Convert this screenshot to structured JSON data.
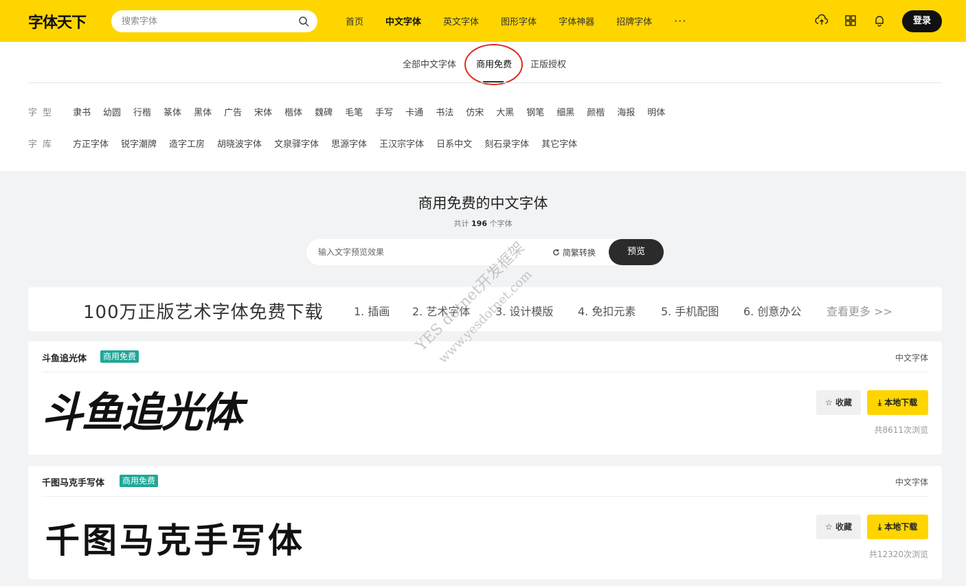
{
  "header": {
    "logo": "字体天下",
    "search_placeholder": "搜索字体",
    "nav": [
      "首页",
      "中文字体",
      "英文字体",
      "图形字体",
      "字体神器",
      "招牌字体"
    ],
    "nav_active": "中文字体",
    "nav_more": "···",
    "login": "登录",
    "icons": [
      "upload-icon",
      "grid-icon",
      "bell-icon"
    ]
  },
  "subtabs": [
    "全部中文字体",
    "商用免费",
    "正版授权"
  ],
  "subtab_active": "商用免费",
  "filters": {
    "style_label": "字型",
    "styles": [
      "隶书",
      "幼圆",
      "行楷",
      "篆体",
      "黑体",
      "广告",
      "宋体",
      "楷体",
      "魏碑",
      "毛笔",
      "手写",
      "卡通",
      "书法",
      "仿宋",
      "大黑",
      "钢笔",
      "细黑",
      "颜楷",
      "海报",
      "明体"
    ],
    "library_label": "字库",
    "libraries": [
      "方正字体",
      "锐字潮牌",
      "造字工房",
      "胡晓波字体",
      "文泉驿字体",
      "思源字体",
      "王汉宗字体",
      "日系中文",
      "刻石录字体",
      "其它字体"
    ]
  },
  "section": {
    "title": "商用免费的中文字体",
    "count_prefix": "共计",
    "count": "196",
    "count_suffix": "个字体",
    "preview_placeholder": "输入文字预览效果",
    "convert": "简繁转换",
    "preview_button": "预览"
  },
  "banner": {
    "headline": "100万正版艺术字体免费下载",
    "categories": [
      "1. 插画",
      "2. 艺术字体",
      "3. 设计模版",
      "4. 免扣元素",
      "5. 手机配图",
      "6. 创意办公"
    ],
    "more": "查看更多 >>"
  },
  "fonts": [
    {
      "name": "斗鱼追光体",
      "badge": "商用免费",
      "type": "中文字体",
      "sample": "斗鱼追光体",
      "fav": "收藏",
      "download": "本地下载",
      "views": "共8611次浏览"
    },
    {
      "name": "千图马克手写体",
      "badge": "商用免费",
      "type": "中文字体",
      "sample": "千图马克手写体",
      "fav": "收藏",
      "download": "本地下载",
      "views": "共12320次浏览"
    }
  ],
  "watermark": [
    "YES dotnet开发框架",
    "www.yesdotnet.com"
  ],
  "colors": {
    "brand_yellow": "#ffd500",
    "badge_green": "#1fa797",
    "circle_red": "#e0281f"
  }
}
